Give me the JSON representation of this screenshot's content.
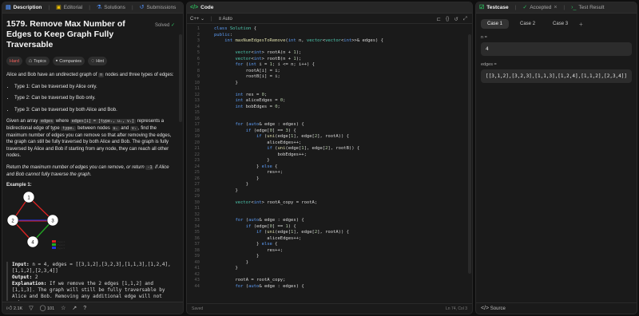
{
  "left_panel": {
    "tabs": [
      {
        "label": "Description",
        "icon": "document-icon"
      },
      {
        "label": "Editorial",
        "icon": "book-icon"
      },
      {
        "label": "Solutions",
        "icon": "flask-icon"
      },
      {
        "label": "Submissions",
        "icon": "history-icon"
      }
    ],
    "title": "1579. Remove Max Number of Edges to Keep Graph Fully Traversable",
    "solved_label": "Solved",
    "chips": [
      "Hard",
      "Topics",
      "Companies",
      "Hint"
    ],
    "intro_a": "Alice and Bob have an undirected graph of",
    "intro_code": "n",
    "intro_b": "nodes and three types of edges:",
    "bullets": [
      "Type 1: Can be traversed by Alice only.",
      "Type 2: Can be traversed by Bob only.",
      "Type 3: Can be traversed by both Alice and Bob."
    ],
    "para2_a": "Given an array",
    "para2_code1": "edges",
    "para2_b": "where",
    "para2_code2": "edges[i] = [typeᵢ, uᵢ, vᵢ]",
    "para2_c": "represents a bidirectional edge of type",
    "para2_code3": "typeᵢ",
    "para2_d": "between nodes",
    "para2_code4": "uᵢ",
    "para2_e": "and",
    "para2_code5": "vᵢ",
    "para2_f": ", find the maximum number of edges you can remove so that after removing the edges, the graph can still be fully traversed by both Alice and Bob. The graph is fully traversed by Alice and Bob if starting from any node, they can reach all other nodes.",
    "para3_a": "Return",
    "para3_b": "the maximum number of edges you can remove, or return",
    "para3_code": "-1",
    "para3_c": "if Alice and Bob cannot fully traverse the graph.",
    "example_title": "Example 1:",
    "graph_nodes": [
      "1",
      "2",
      "3",
      "4"
    ],
    "graph_legend": [
      "Type 1",
      "Type 2",
      "Type 3"
    ],
    "example": {
      "input_label": "Input:",
      "input_value": "n = 4, edges = [[3,1,2],[3,2,3],[1,1,3],[1,2,4],[1,1,2],[2,3,4]]",
      "output_label": "Output:",
      "output_value": "2",
      "explanation_label": "Explanation:",
      "explanation_value": "If we remove the 2 edges [1,1,2] and [1,1,3]. The graph will still be fully traversable by Alice and Bob. Removing any additional edge will not make"
    },
    "footer": {
      "likes": "2.1K",
      "comments": "101"
    }
  },
  "editor": {
    "tab_label": "Code",
    "language": "C++",
    "auto_label": "Auto",
    "status_saved": "Saved",
    "status_pos": "Ln 74, Col 3",
    "lines": [
      {
        "n": "1",
        "t": "class Solution {"
      },
      {
        "n": "2",
        "t": "public:"
      },
      {
        "n": "3",
        "t": "    int maxNumEdgesToRemove(int n, vector<vector<int>>& edges) {"
      },
      {
        "n": "4",
        "t": ""
      },
      {
        "n": "5",
        "t": "        vector<int> rootA(n + 1);"
      },
      {
        "n": "6",
        "t": "        vector<int> rootB(n + 1);"
      },
      {
        "n": "7",
        "t": "        for (int i = 1; i <= n; i++) {"
      },
      {
        "n": "8",
        "t": "            rootA[i] = i;"
      },
      {
        "n": "9",
        "t": "            rootB[i] = i;"
      },
      {
        "n": "10",
        "t": "        }"
      },
      {
        "n": "11",
        "t": ""
      },
      {
        "n": "12",
        "t": "        int res = 0;"
      },
      {
        "n": "13",
        "t": "        int aliceEdges = 0;"
      },
      {
        "n": "14",
        "t": "        int bobEdges = 0;"
      },
      {
        "n": "15",
        "t": ""
      },
      {
        "n": "16",
        "t": ""
      },
      {
        "n": "17",
        "t": "        for (auto& edge : edges) {"
      },
      {
        "n": "18",
        "t": "            if (edge[0] == 3) {"
      },
      {
        "n": "19",
        "t": "                if (uni(edge[1], edge[2], rootA)) {"
      },
      {
        "n": "20",
        "t": "                    aliceEdges++;"
      },
      {
        "n": "21",
        "t": "                    if (uni(edge[1], edge[2], rootB)) {"
      },
      {
        "n": "22",
        "t": "                        bobEdges++;"
      },
      {
        "n": "23",
        "t": "                    }"
      },
      {
        "n": "24",
        "t": "                } else {"
      },
      {
        "n": "25",
        "t": "                    res++;"
      },
      {
        "n": "26",
        "t": "                }"
      },
      {
        "n": "27",
        "t": "            }"
      },
      {
        "n": "28",
        "t": "        }"
      },
      {
        "n": "29",
        "t": ""
      },
      {
        "n": "30",
        "t": "        vector<int> rootA_copy = rootA;"
      },
      {
        "n": "31",
        "t": ""
      },
      {
        "n": "32",
        "t": ""
      },
      {
        "n": "33",
        "t": "        for (auto& edge : edges) {"
      },
      {
        "n": "34",
        "t": "            if (edge[0] == 1) {"
      },
      {
        "n": "35",
        "t": "                if (uni(edge[1], edge[2], rootA)) {"
      },
      {
        "n": "36",
        "t": "                    aliceEdges++;"
      },
      {
        "n": "37",
        "t": "                } else {"
      },
      {
        "n": "38",
        "t": "                    res++;"
      },
      {
        "n": "39",
        "t": "                }"
      },
      {
        "n": "40",
        "t": "            }"
      },
      {
        "n": "41",
        "t": "        }"
      },
      {
        "n": "42",
        "t": ""
      },
      {
        "n": "43",
        "t": "        rootA = rootA_copy;"
      },
      {
        "n": "44",
        "t": "        for (auto& edge : edges) {"
      }
    ]
  },
  "testcase": {
    "tabs": [
      {
        "label": "Testcase",
        "icon": "checkbox-icon"
      },
      {
        "label": "Accepted",
        "icon": "check-icon"
      },
      {
        "label": "Test Result",
        "icon": "terminal-icon"
      }
    ],
    "cases": [
      "Case 1",
      "Case 2",
      "Case 3"
    ],
    "add_label": "+",
    "fields": [
      {
        "label": "n =",
        "value": "4"
      },
      {
        "label": "edges =",
        "value": "[[3,1,2],[3,2,3],[1,1,3],[1,2,4],[1,1,2],[2,3,4]]"
      }
    ],
    "source_label": "Source"
  },
  "colors": {
    "accent_green": "#2cbb5d",
    "hard": "#f8615c",
    "keyword": "#5c9cf5",
    "type": "#4ec9b0"
  }
}
